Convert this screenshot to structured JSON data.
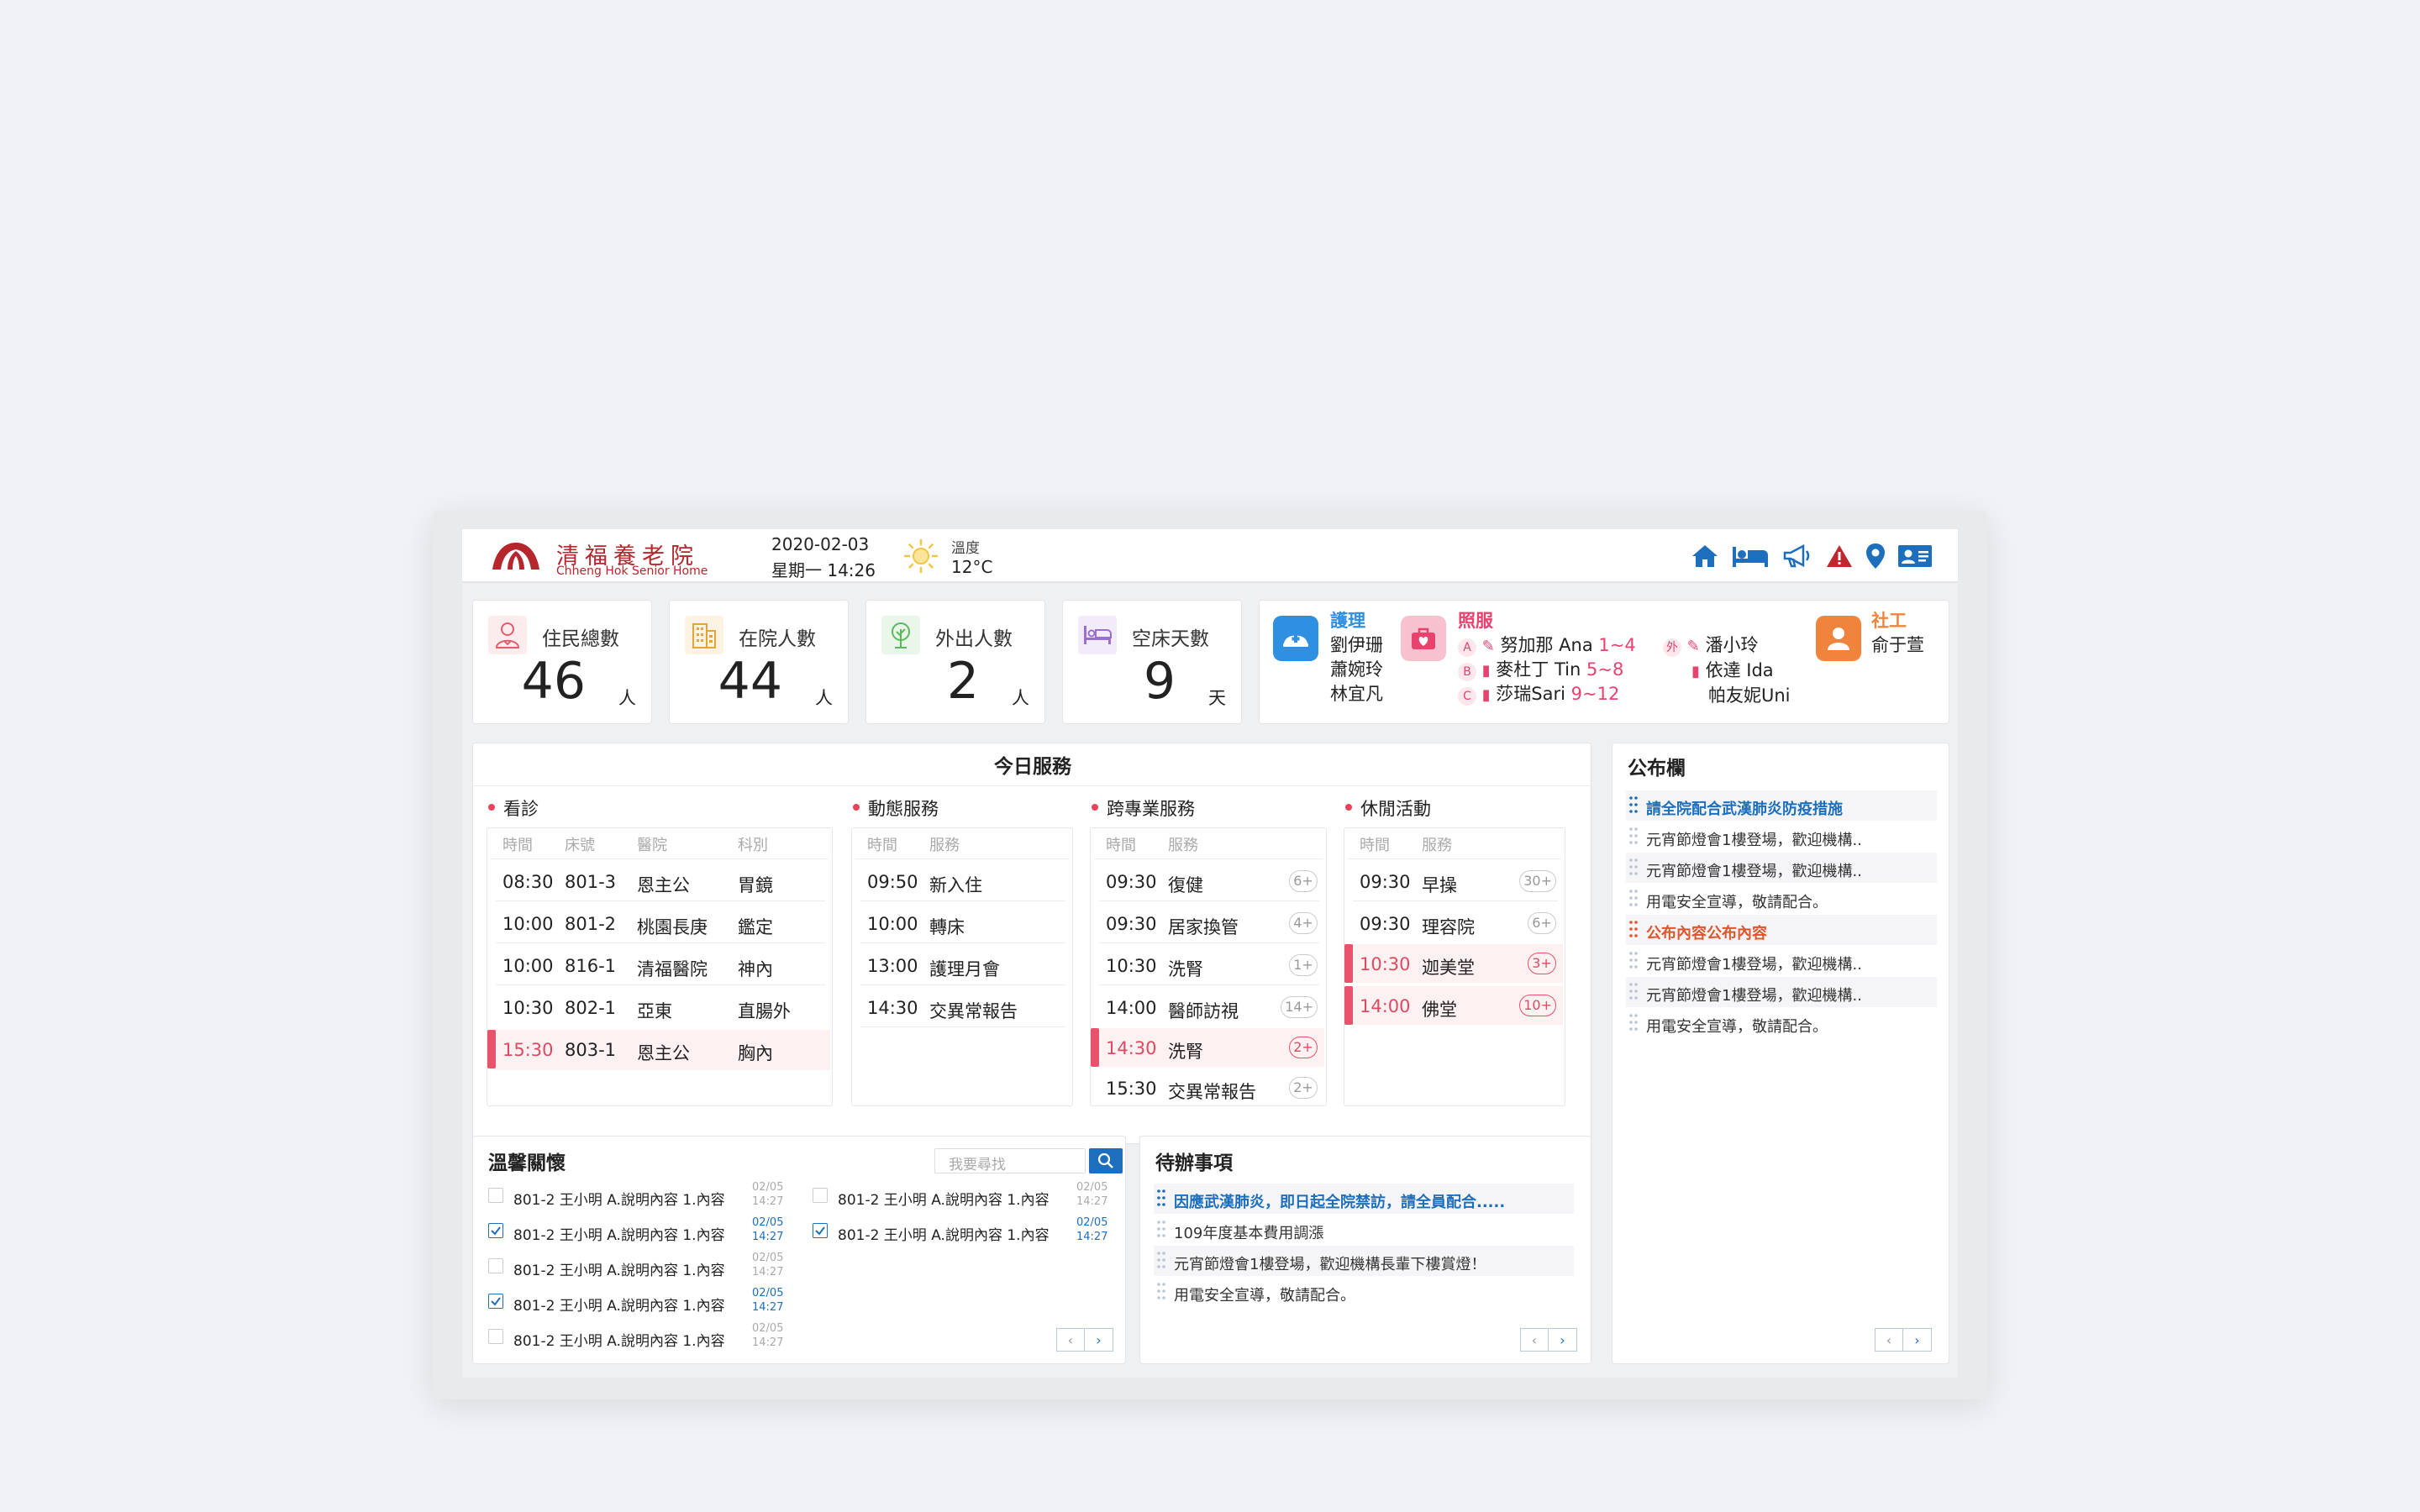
{
  "header": {
    "logo_cn": "清福養老院",
    "logo_en": "Chheng Hok Senior Home",
    "date": "2020-02-03",
    "weekday_time": "星期一 14:26",
    "weather_icon": "sun-icon",
    "temp_label": "溫度",
    "temp_value": "12°C",
    "icons": [
      "home-icon",
      "bed-icon",
      "megaphone-icon",
      "warning-icon",
      "location-pin-icon",
      "id-card-icon"
    ]
  },
  "stats": [
    {
      "label": "住民總數",
      "value": "46",
      "unit": "人",
      "icon": "resident-icon",
      "color": "#e35d6a"
    },
    {
      "label": "在院人數",
      "value": "44",
      "unit": "人",
      "icon": "building-icon",
      "color": "#e6a23c"
    },
    {
      "label": "外出人數",
      "value": "2",
      "unit": "人",
      "icon": "tree-icon",
      "color": "#5cb85c"
    },
    {
      "label": "空床天數",
      "value": "9",
      "unit": "天",
      "icon": "bed-icon",
      "color": "#9b6fcf"
    }
  ],
  "staff": {
    "nursing": {
      "title": "護理",
      "names": [
        "劉伊珊",
        "蕭婉玲",
        "林宜凡"
      ],
      "icon": "nurse-cap-icon",
      "color": "#2f8fe0"
    },
    "care": {
      "title": "照服",
      "icon": "care-bag-icon",
      "color": "#e8426e",
      "groups": [
        {
          "tag": "A",
          "name": "努加那 Ana",
          "range": "1~4"
        },
        {
          "tag": "B",
          "name": "麥杜丁 Tin",
          "range": "5~8"
        },
        {
          "tag": "C",
          "name": "莎瑞Sari",
          "range": "9~12"
        }
      ],
      "out_tag": "外",
      "extra": [
        "潘小玲",
        "依達 Ida",
        "帕友妮Uni"
      ]
    },
    "social": {
      "title": "社工",
      "names": [
        "俞于萱"
      ],
      "icon": "person-icon",
      "color": "#f0843c"
    }
  },
  "today": {
    "title": "今日服務",
    "clinic": {
      "title": "看診",
      "headers": [
        "時間",
        "床號",
        "醫院",
        "科別"
      ],
      "rows": [
        [
          "08:30",
          "801-3",
          "恩主公",
          "胃鏡"
        ],
        [
          "10:00",
          "801-2",
          "桃園長庚",
          "鑑定"
        ],
        [
          "10:00",
          "816-1",
          "清福醫院",
          "神內"
        ],
        [
          "10:30",
          "802-1",
          "亞東",
          "直腸外"
        ],
        [
          "15:30",
          "803-1",
          "恩主公",
          "胸內"
        ]
      ]
    },
    "dynamic": {
      "title": "動態服務",
      "headers": [
        "時間",
        "服務"
      ],
      "rows": [
        [
          "09:50",
          "新入住"
        ],
        [
          "10:00",
          "轉床"
        ],
        [
          "13:00",
          "護理月會"
        ],
        [
          "14:30",
          "交異常報告"
        ]
      ]
    },
    "cross": {
      "title": "跨專業服務",
      "headers": [
        "時間",
        "服務"
      ],
      "rows": [
        [
          "09:30",
          "復健",
          "6+"
        ],
        [
          "09:30",
          "居家換管",
          "4+"
        ],
        [
          "10:30",
          "洗腎",
          "1+"
        ],
        [
          "14:00",
          "醫師訪視",
          "14+"
        ],
        [
          "14:30",
          "洗腎",
          "2+"
        ],
        [
          "15:30",
          "交異常報告",
          "2+"
        ]
      ]
    },
    "leisure": {
      "title": "休閒活動",
      "headers": [
        "時間",
        "服務"
      ],
      "rows": [
        [
          "09:30",
          "早操",
          "30+"
        ],
        [
          "09:30",
          "理容院",
          "6+"
        ],
        [
          "10:30",
          "迦美堂",
          "3+"
        ],
        [
          "14:00",
          "佛堂",
          "10+"
        ]
      ]
    }
  },
  "bulletin": {
    "title": "公布欄",
    "items": [
      "請全院配合武漢肺炎防疫措施",
      "元宵節燈會1樓登場，歡迎機構..",
      "元宵節燈會1樓登場，歡迎機構..",
      "用電安全宣導，敬請配合。",
      "公布內容公布內容",
      "元宵節燈會1樓登場，歡迎機構..",
      "元宵節燈會1樓登場，歡迎機構..",
      "用電安全宣導，敬請配合。"
    ]
  },
  "care": {
    "title": "溫馨關懷",
    "search_placeholder": "我要尋找",
    "left": [
      {
        "text": "801-2 王小明 A.說明內容 1.內容",
        "date": "02/05",
        "time": "14:27",
        "checked": false
      },
      {
        "text": "801-2 王小明 A.說明內容 1.內容",
        "date": "02/05",
        "time": "14:27",
        "checked": true
      },
      {
        "text": "801-2 王小明 A.說明內容 1.內容",
        "date": "02/05",
        "time": "14:27",
        "checked": false
      },
      {
        "text": "801-2 王小明 A.說明內容 1.內容",
        "date": "02/05",
        "time": "14:27",
        "checked": true
      },
      {
        "text": "801-2 王小明 A.說明內容 1.內容",
        "date": "02/05",
        "time": "14:27",
        "checked": false
      }
    ],
    "right": [
      {
        "text": "801-2 王小明 A.說明內容 1.內容",
        "date": "02/05",
        "time": "14:27",
        "checked": false
      },
      {
        "text": "801-2 王小明 A.說明內容 1.內容",
        "date": "02/05",
        "time": "14:27",
        "checked": true
      }
    ]
  },
  "todo": {
    "title": "待辦事項",
    "items": [
      "因應武漢肺炎，即日起全院禁訪，請全員配合.....",
      "109年度基本費用調漲",
      "元宵節燈會1樓登場，歡迎機構長輩下樓賞燈！",
      "用電安全宣導，敬請配合。"
    ]
  },
  "pager": {
    "prev": "‹",
    "next": "›"
  }
}
